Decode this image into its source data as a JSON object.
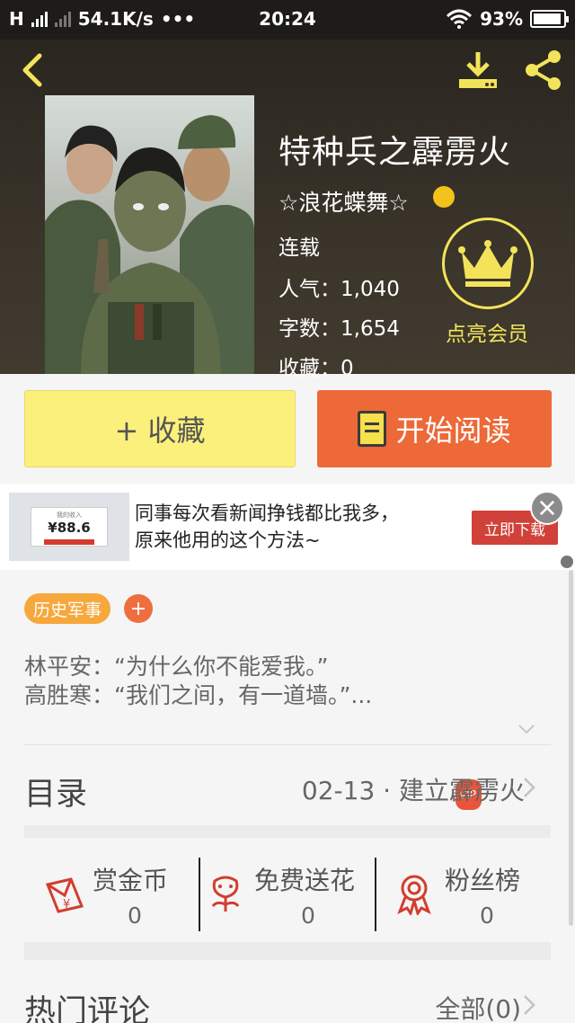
{
  "status_bar": {
    "network": "H",
    "speed": "54.1K/s",
    "dots": "•••",
    "time": "20:24",
    "battery": "93%",
    "battery_level": 0.93
  },
  "header": {
    "icons": [
      "back-arrow-icon",
      "download-icon",
      "share-icon"
    ]
  },
  "book": {
    "title": "特种兵之霹雳火",
    "author": "☆浪花蝶舞☆",
    "vip_label": "VIP",
    "status": "连载",
    "popularity": "人气：1,040",
    "word_count": "字数：1,654",
    "favorites": "收藏：0"
  },
  "member": {
    "label": "点亮会员"
  },
  "actions": {
    "collect_label": "+ 收藏",
    "read_label": "开始阅读"
  },
  "ad": {
    "thumb_card_value": "¥88.6",
    "thumb_card_caption": "我的收入",
    "line1": "同事每次看新闻挣钱都比我多，",
    "line2": "原来他用的这个方法~",
    "button_label": "立即下载"
  },
  "tags": {
    "category": "历史军事",
    "add": "+"
  },
  "description": {
    "line1": "林平安：“为什么你不能爱我。”",
    "line2": "高胜寒：“我们之间，有一道墙。”..."
  },
  "catalog": {
    "label": "目录",
    "latest": "02-13 · 建立霹雳火"
  },
  "stats": [
    {
      "label": "赏金币",
      "value": "0",
      "icon": "red-envelope-icon"
    },
    {
      "label": "免费送花",
      "value": "0",
      "icon": "flower-icon"
    },
    {
      "label": "粉丝榜",
      "value": "0",
      "icon": "medal-icon"
    }
  ],
  "comments": {
    "label": "热门评论",
    "all_label": "全部(0)"
  },
  "colors": {
    "header_bg": "#2f2a22",
    "collect_bg": "#fbf07c",
    "read_bg": "#ed6938",
    "member_gold": "#f3e35a",
    "tag_orange": "#f6a83c",
    "ad_button": "#d0413a"
  }
}
